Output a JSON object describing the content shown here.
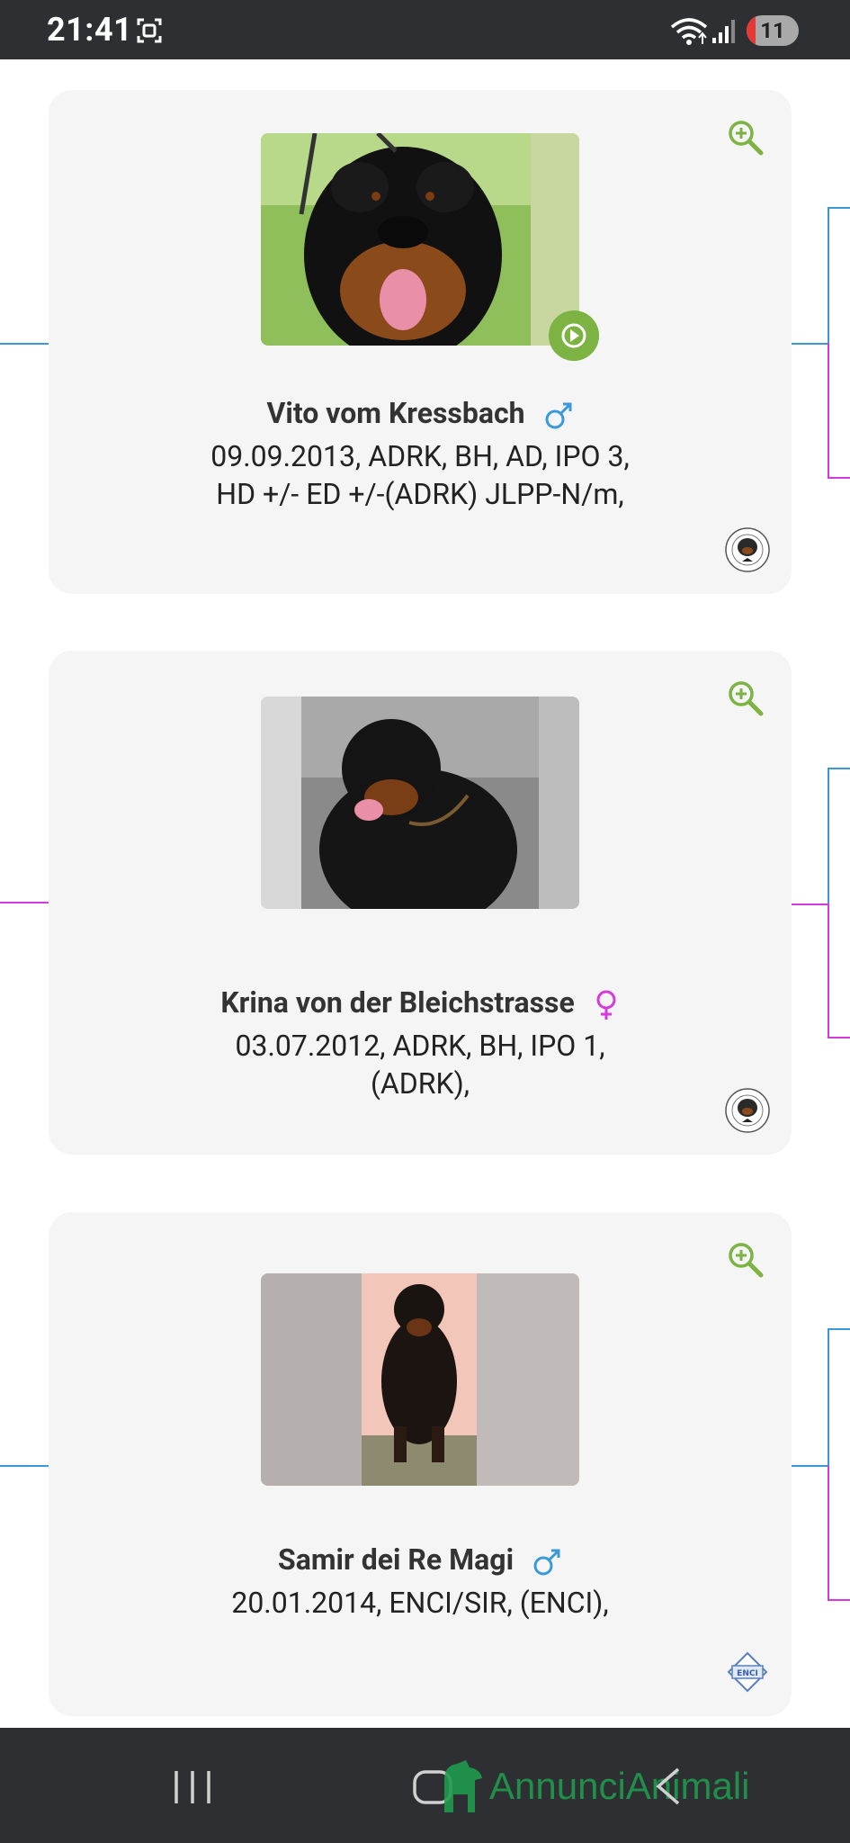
{
  "status_bar": {
    "time": "21:41",
    "battery": "11",
    "icons": [
      "screenshot-icon",
      "wifi-icon",
      "signal-icon",
      "battery-icon"
    ]
  },
  "dogs": [
    {
      "name": "Vito vom Kressbach",
      "sex": "male",
      "info": "09.09.2013, ADRK, BH, AD, IPO 3, HD +/- ED +/-(ADRK) JLPP-N/m,",
      "has_video": true,
      "club": "ADRK"
    },
    {
      "name": "Krina von der Bleichstrasse",
      "sex": "female",
      "info": "03.07.2012, ADRK, BH, IPO 1, (ADRK),",
      "has_video": false,
      "club": "ADRK"
    },
    {
      "name": "Samir dei Re Magi",
      "sex": "male",
      "info": "20.01.2014, ENCI/SIR, (ENCI),",
      "has_video": false,
      "club": "ENCI"
    }
  ],
  "watermark": {
    "text": "AnnunciAnimali"
  },
  "colors": {
    "male": "#3a9ad9",
    "female": "#d63adc",
    "accent": "#7cb342",
    "card": "#f5f5f5",
    "bars": "#2e2f33"
  }
}
